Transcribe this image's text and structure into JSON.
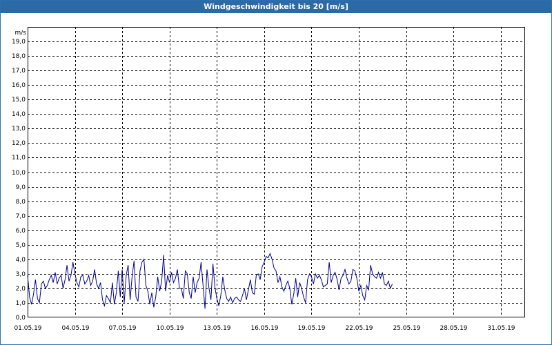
{
  "window": {
    "title": "Windgeschwindigkeit bis 20 [m/s]"
  },
  "colors": {
    "titlebar": "#2c6aa6",
    "series": "#00008b",
    "grid": "#000000"
  },
  "chart_data": {
    "type": "line",
    "title": "Windgeschwindigkeit bis 20 [m/s]",
    "ylabel": "m/s",
    "xlabel": "",
    "ylim": [
      0,
      20
    ],
    "xlim": [
      "01.05.19",
      "01.06.19 12:00"
    ],
    "grid": true,
    "y_ticks": [
      "0,0",
      "1,0",
      "2,0",
      "3,0",
      "4,0",
      "5,0",
      "6,0",
      "7,0",
      "8,0",
      "9,0",
      "10,0",
      "11,0",
      "12,0",
      "13,0",
      "14,0",
      "15,0",
      "16,0",
      "17,0",
      "18,0",
      "19,0"
    ],
    "x_ticks": [
      "01.05.19",
      "04.05.19",
      "07.05.19",
      "10.05.19",
      "13.05.19",
      "16.05.19",
      "19.05.19",
      "22.05.19",
      "25.05.19",
      "28.05.19",
      "31.05.19"
    ],
    "series": [
      {
        "x_start": "01.05.19 00:00",
        "x_step": "3 h",
        "values": [
          2.9,
          1.4,
          0.9,
          1.6,
          2.6,
          1.3,
          1.0,
          2.3,
          2.5,
          2.0,
          2.2,
          2.6,
          2.9,
          2.4,
          3.1,
          2.3,
          2.7,
          2.9,
          2.0,
          2.6,
          3.6,
          2.5,
          2.9,
          3.8,
          3.0,
          2.4,
          2.1,
          2.8,
          2.9,
          2.3,
          2.5,
          2.9,
          2.2,
          2.5,
          3.3,
          2.3,
          2.0,
          2.4,
          1.2,
          0.8,
          1.5,
          1.3,
          1.0,
          2.4,
          0.9,
          1.7,
          3.2,
          1.4,
          3.3,
          1.0,
          2.9,
          3.6,
          1.2,
          2.8,
          3.9,
          1.4,
          1.1,
          3.2,
          3.8,
          4.0,
          2.2,
          1.8,
          0.9,
          1.7,
          0.7,
          1.4,
          2.8,
          1.8,
          2.5,
          4.3,
          1.8,
          2.9,
          2.4,
          3.1,
          2.4,
          2.7,
          3.3,
          2.0,
          2.0,
          1.3,
          3.2,
          3.0,
          1.7,
          1.3,
          2.8,
          1.7,
          2.4,
          2.7,
          3.8,
          2.2,
          0.6,
          3.3,
          2.0,
          1.2,
          3.7,
          2.1,
          1.3,
          0.8,
          1.5,
          2.8,
          1.9,
          1.3,
          1.1,
          1.4,
          1.0,
          1.3,
          1.4,
          1.2,
          1.1,
          1.5,
          2.0,
          1.2,
          1.9,
          2.6,
          1.7,
          1.6,
          2.9,
          3.0,
          2.6,
          3.5,
          3.8,
          4.2,
          4.1,
          4.4,
          4.0,
          3.4,
          3.2,
          2.4,
          2.8,
          2.1,
          1.8,
          2.2,
          2.5,
          2.0,
          0.9,
          1.6,
          2.7,
          1.4,
          2.4,
          2.0,
          1.4,
          1.0,
          2.6,
          3.0,
          2.8,
          2.3,
          3.0,
          2.7,
          2.9,
          2.6,
          2.1,
          2.2,
          2.3,
          3.8,
          2.4,
          2.9,
          3.1,
          2.6,
          1.9,
          2.7,
          2.9,
          3.3,
          2.7,
          2.3,
          2.5,
          3.3,
          3.2,
          2.7,
          1.8,
          2.2,
          1.5,
          1.2,
          2.2,
          1.9,
          3.6,
          3.0,
          2.8,
          2.7,
          3.1,
          2.7,
          3.1,
          2.3,
          2.2,
          2.5,
          2.0,
          2.3
        ]
      }
    ]
  }
}
